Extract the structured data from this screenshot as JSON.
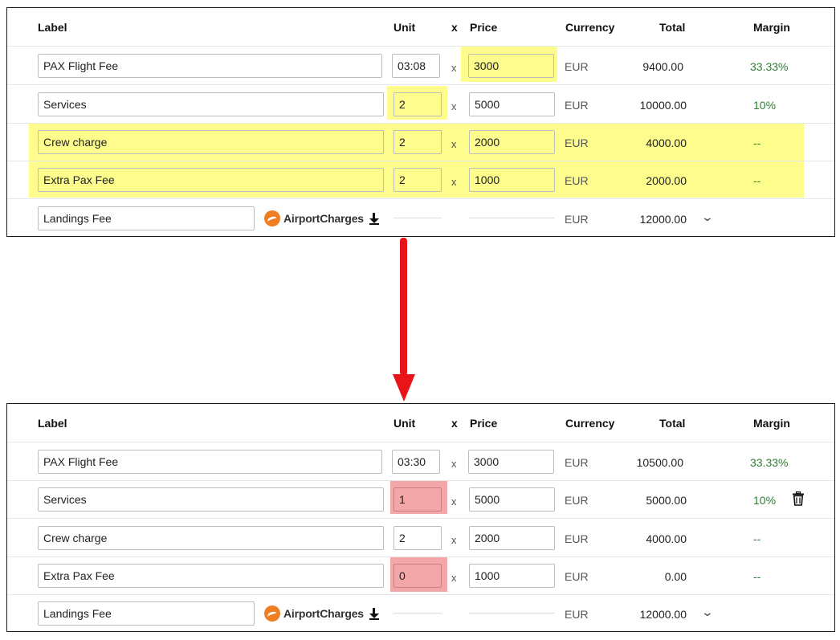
{
  "headers": {
    "label": "Label",
    "unit": "Unit",
    "x": "x",
    "price": "Price",
    "currency": "Currency",
    "total": "Total",
    "margin": "Margin"
  },
  "airport_charges_label": "AirportCharges",
  "colors": {
    "highlight_yellow": "#fdfc8d",
    "highlight_red": "#f3a7a9",
    "margin_green": "#2e7d32",
    "arrow_red": "#e8141a"
  },
  "before": {
    "rows": [
      {
        "label": "PAX Flight Fee",
        "unit": "03:08",
        "price": "3000",
        "currency": "EUR",
        "total": "9400.00",
        "margin": "33.33%"
      },
      {
        "label": "Services",
        "unit": "2",
        "price": "5000",
        "currency": "EUR",
        "total": "10000.00",
        "margin": "10%"
      },
      {
        "label": "Crew charge",
        "unit": "2",
        "price": "2000",
        "currency": "EUR",
        "total": "4000.00",
        "margin": "--"
      },
      {
        "label": "Extra Pax Fee",
        "unit": "2",
        "price": "1000",
        "currency": "EUR",
        "total": "2000.00",
        "margin": "--"
      },
      {
        "label": "Landings Fee",
        "currency": "EUR",
        "total": "12000.00"
      }
    ]
  },
  "after": {
    "rows": [
      {
        "label": "PAX Flight Fee",
        "unit": "03:30",
        "price": "3000",
        "currency": "EUR",
        "total": "10500.00",
        "margin": "33.33%"
      },
      {
        "label": "Services",
        "unit": "1",
        "price": "5000",
        "currency": "EUR",
        "total": "5000.00",
        "margin": "10%"
      },
      {
        "label": "Crew charge",
        "unit": "2",
        "price": "2000",
        "currency": "EUR",
        "total": "4000.00",
        "margin": "--"
      },
      {
        "label": "Extra Pax Fee",
        "unit": "0",
        "price": "1000",
        "currency": "EUR",
        "total": "0.00",
        "margin": "--"
      },
      {
        "label": "Landings Fee",
        "currency": "EUR",
        "total": "12000.00"
      }
    ]
  }
}
